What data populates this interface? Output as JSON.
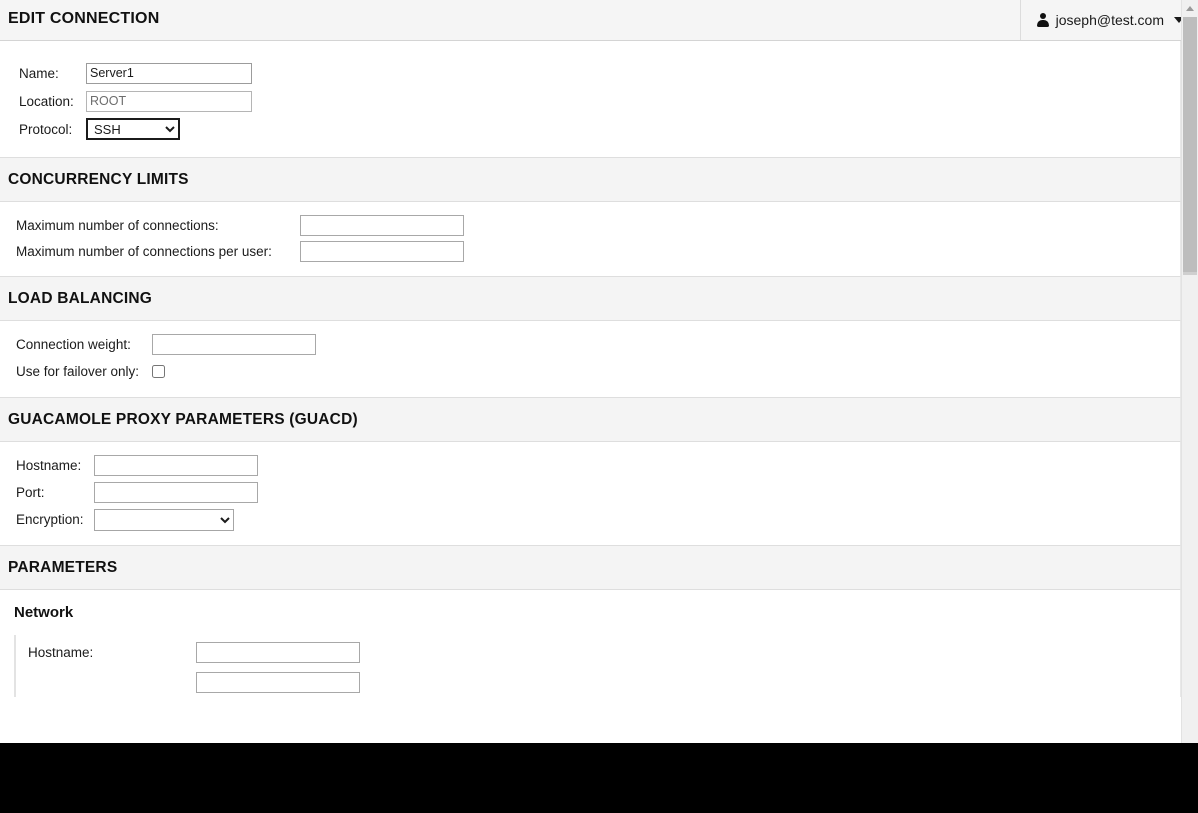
{
  "header": {
    "title": "EDIT CONNECTION",
    "user": {
      "icon": "person-icon",
      "label": "joseph@test.com",
      "caret_icon": "chevron-down-icon"
    }
  },
  "scrollbar": {
    "up_arrow_icon": "scroll-up-arrow-icon"
  },
  "connection": {
    "fields": {
      "name_label": "Name:",
      "name_value": "Server1",
      "location_label": "Location:",
      "location_value": "ROOT",
      "protocol_label": "Protocol:",
      "protocol_value": "SSH",
      "protocol_options": [
        "SSH"
      ]
    }
  },
  "concurrency": {
    "title": "CONCURRENCY LIMITS",
    "fields": {
      "max_connections_label": "Maximum number of connections:",
      "max_connections_value": "",
      "max_connections_per_user_label": "Maximum number of connections per user:",
      "max_connections_per_user_value": ""
    }
  },
  "load_balancing": {
    "title": "LOAD BALANCING",
    "fields": {
      "connection_weight_label": "Connection weight:",
      "connection_weight_value": "",
      "failover_only_label": "Use for failover only:",
      "failover_only_checked": false
    }
  },
  "guacd": {
    "title": "GUACAMOLE PROXY PARAMETERS (GUACD)",
    "fields": {
      "hostname_label": "Hostname:",
      "hostname_value": "",
      "port_label": "Port:",
      "port_value": "",
      "encryption_label": "Encryption:",
      "encryption_value": "",
      "encryption_options": [
        ""
      ]
    }
  },
  "parameters": {
    "title": "PARAMETERS",
    "network": {
      "subsection_title": "Network",
      "hostname_label": "Hostname:",
      "hostname_value": ""
    }
  }
}
